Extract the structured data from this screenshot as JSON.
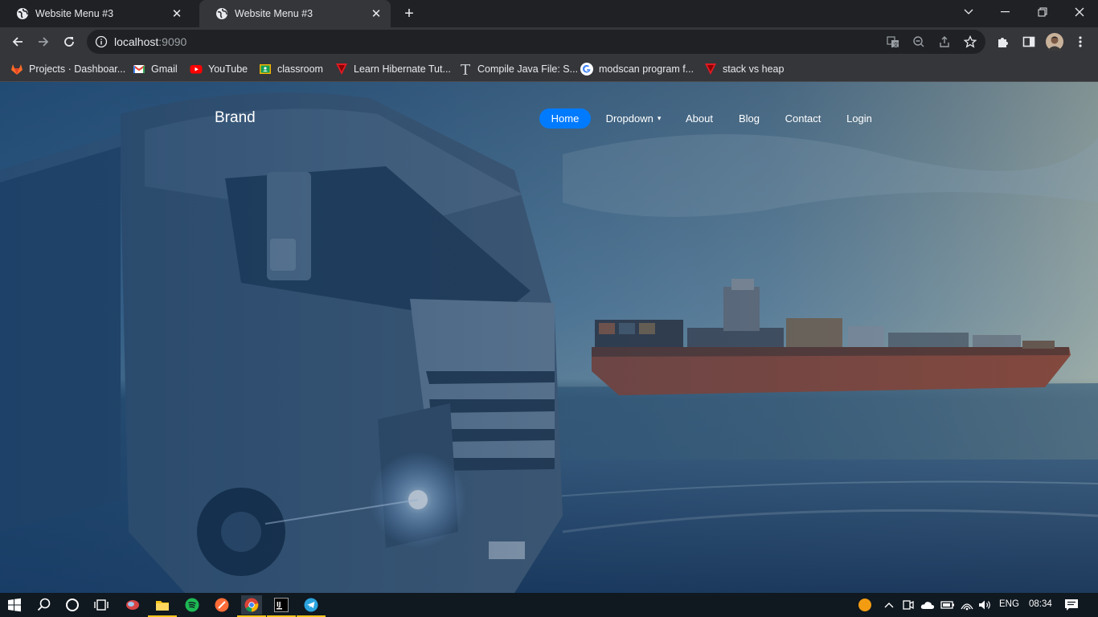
{
  "browser": {
    "tabs": [
      {
        "title": "Website Menu #3",
        "active": false
      },
      {
        "title": "Website Menu #3",
        "active": true
      }
    ],
    "address": {
      "host": "localhost",
      "port": ":9090"
    },
    "bookmarks": [
      {
        "label": "Projects · Dashboar...",
        "icon": "gitlab-icon"
      },
      {
        "label": "Gmail",
        "icon": "gmail-icon"
      },
      {
        "label": "YouTube",
        "icon": "youtube-icon"
      },
      {
        "label": "classroom",
        "icon": "classroom-icon"
      },
      {
        "label": "Learn Hibernate Tut...",
        "icon": "red-v-icon"
      },
      {
        "label": "Compile Java File: S...",
        "icon": "t-icon"
      },
      {
        "label": "modscan program f...",
        "icon": "google-icon"
      },
      {
        "label": "stack vs heap",
        "icon": "red-v-icon"
      }
    ]
  },
  "page": {
    "brand": "Brand",
    "nav": [
      {
        "label": "Home",
        "active": true
      },
      {
        "label": "Dropdown",
        "has_caret": true
      },
      {
        "label": "About"
      },
      {
        "label": "Blog"
      },
      {
        "label": "Contact"
      },
      {
        "label": "Login"
      }
    ],
    "accent_color": "#007bff"
  },
  "taskbar": {
    "language": "ENG",
    "time": "08:34"
  }
}
